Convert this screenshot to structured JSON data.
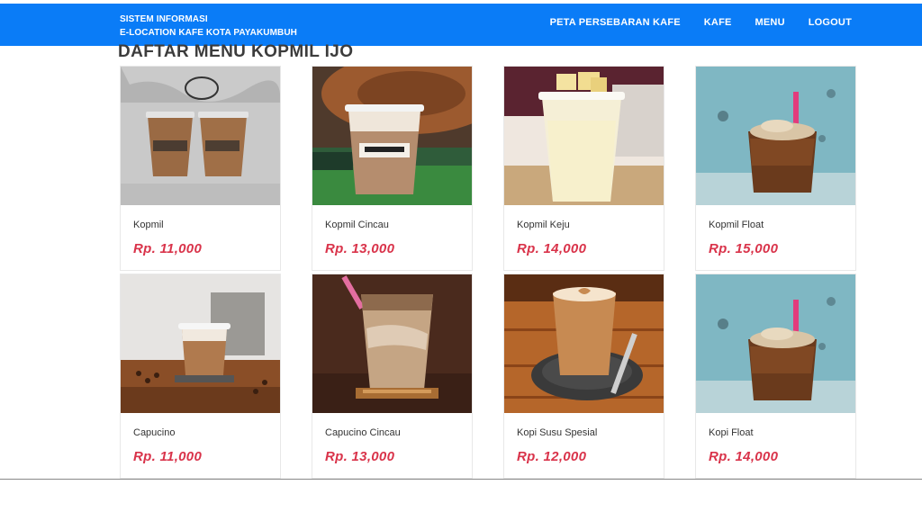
{
  "header": {
    "brand_line1": "SISTEM INFORMASI",
    "brand_line2": "E-LOCATION KAFE KOTA PAYAKUMBUH",
    "nav": [
      {
        "label": "PETA PERSEBARAN KAFE"
      },
      {
        "label": "KAFE"
      },
      {
        "label": "MENU"
      },
      {
        "label": "LOGOUT"
      }
    ],
    "bar_color": "#0a7cf7"
  },
  "page": {
    "title": "DAFTAR MENU KOPMIL IJO"
  },
  "menu_items": [
    {
      "name": "Kopmil",
      "price": "Rp. 11,000",
      "image": "two-iced-coffee-cups-image"
    },
    {
      "name": "Kopmil Cincau",
      "price": "Rp. 13,000",
      "image": "iced-coffee-guitar-image"
    },
    {
      "name": "Kopmil Keju",
      "price": "Rp. 14,000",
      "image": "cheese-drink-image"
    },
    {
      "name": "Kopmil Float",
      "price": "Rp. 15,000",
      "image": "float-drink-image"
    },
    {
      "name": "Capucino",
      "price": "Rp. 11,000",
      "image": "capucino-beans-image"
    },
    {
      "name": "Capucino Cincau",
      "price": "Rp. 13,000",
      "image": "iced-capucino-straw-image"
    },
    {
      "name": "Kopi Susu Spesial",
      "price": "Rp. 12,000",
      "image": "latte-art-glass-image"
    },
    {
      "name": "Kopi Float",
      "price": "Rp. 14,000",
      "image": "float-drink-image"
    }
  ],
  "colors": {
    "price": "#d9334a",
    "accent": "#0a7cf7"
  }
}
